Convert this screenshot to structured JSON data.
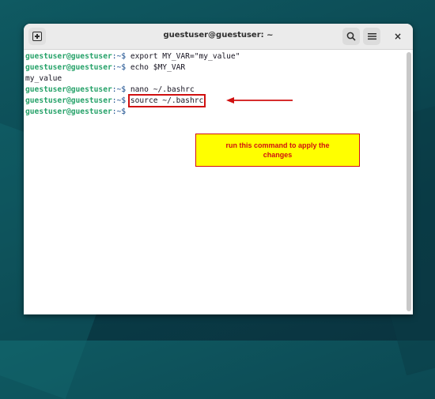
{
  "window": {
    "title": "guestuser@guestuser: ~"
  },
  "terminal": {
    "lines": [
      {
        "user": "guestuser@guestuser",
        "path": ":~$ ",
        "cmd": "export MY_VAR=\"my_value\""
      },
      {
        "user": "guestuser@guestuser",
        "path": ":~$ ",
        "cmd": "echo $MY_VAR"
      },
      {
        "output": "my_value"
      },
      {
        "user": "guestuser@guestuser",
        "path": ":~$ ",
        "cmd": "nano ~/.bashrc"
      },
      {
        "user": "guestuser@guestuser",
        "path": ":~$ ",
        "cmd": "source ~/.bashrc"
      },
      {
        "user": "guestuser@guestuser",
        "path": ":~$ ",
        "cmd": ""
      }
    ]
  },
  "annotation": {
    "note": "run this command to apply the changes",
    "color": "#d01010",
    "note_bg": "#ffff00"
  },
  "icons": {
    "new_tab": "new-tab-icon",
    "search": "search-icon",
    "menu": "hamburger-menu-icon",
    "close": "close-icon"
  }
}
